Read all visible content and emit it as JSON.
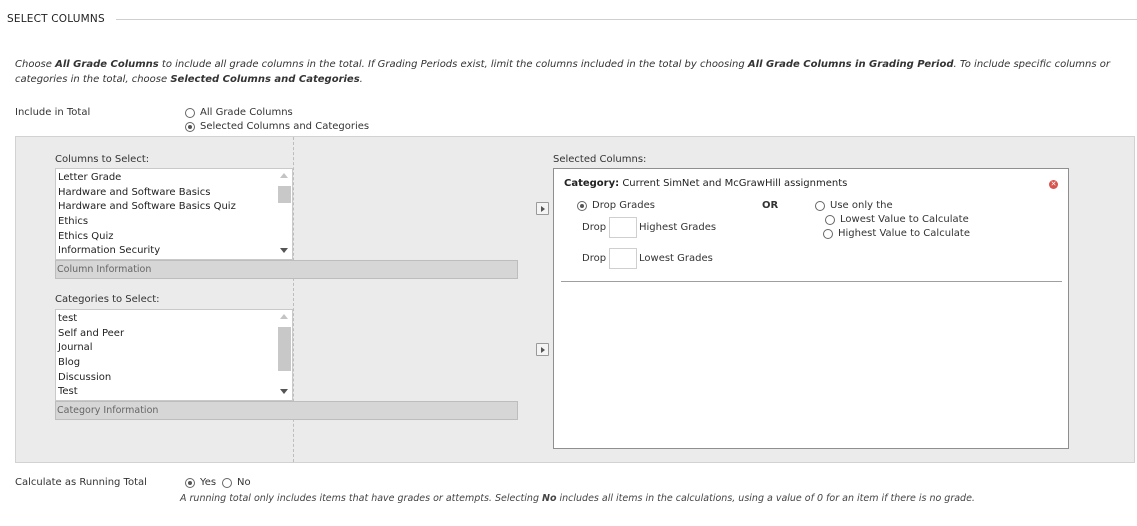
{
  "section": {
    "title": "SELECT COLUMNS"
  },
  "instructions": {
    "part1": "Choose ",
    "bold1": "All Grade Columns",
    "part2": " to include all grade columns in the total. If Grading Periods exist, limit the columns included in the total by choosing ",
    "bold2": "All Grade Columns in Grading Period",
    "part3": ". To include specific columns or categories in the total, choose ",
    "bold3": "Selected Columns and Categories",
    "part4": "."
  },
  "include_in_total": {
    "label": "Include in Total",
    "options": [
      {
        "label": "All Grade Columns",
        "selected": false
      },
      {
        "label": "Selected Columns and Categories",
        "selected": true
      }
    ]
  },
  "columns_to_select": {
    "label": "Columns to Select:",
    "items": [
      "Letter Grade",
      "Hardware and Software Basics",
      "Hardware and Software Basics Quiz",
      "Ethics",
      "Ethics Quiz",
      "Information Security"
    ],
    "info_label": "Column Information"
  },
  "categories_to_select": {
    "label": "Categories to Select:",
    "items": [
      "test",
      "Self and Peer",
      "Journal",
      "Blog",
      "Discussion",
      "Test"
    ],
    "info_label": "Category Information"
  },
  "selected_columns": {
    "label": "Selected Columns:",
    "category_prefix": "Category:",
    "category_name": "Current SimNet and McGrawHill assignments",
    "drop_grades_label": "Drop Grades",
    "or_label": "OR",
    "use_only_label": "Use only the",
    "lowest_value_label": "Lowest Value to Calculate",
    "highest_value_label": "Highest Value to Calculate",
    "drop_label_1": "Drop",
    "highest_grades_label": "Highest Grades",
    "drop_label_2": "Drop",
    "lowest_grades_label": "Lowest Grades",
    "drop_highest_value": "",
    "drop_lowest_value": ""
  },
  "running_total": {
    "label": "Calculate as Running Total",
    "yes_label": "Yes",
    "no_label": "No",
    "yes_selected": true,
    "note_part1": "A running total only includes items that have grades or attempts. Selecting ",
    "note_bold": "No",
    "note_part2": " includes all items in the calculations, using a value of 0 for an item if there is no grade."
  },
  "icons": {
    "move_columns": "chevron-right-icon",
    "move_categories": "chevron-right-icon",
    "remove_category": "close-circle-icon"
  },
  "colors": {
    "panel_bg": "#ebebeb",
    "remove_icon": "#d9534f"
  }
}
